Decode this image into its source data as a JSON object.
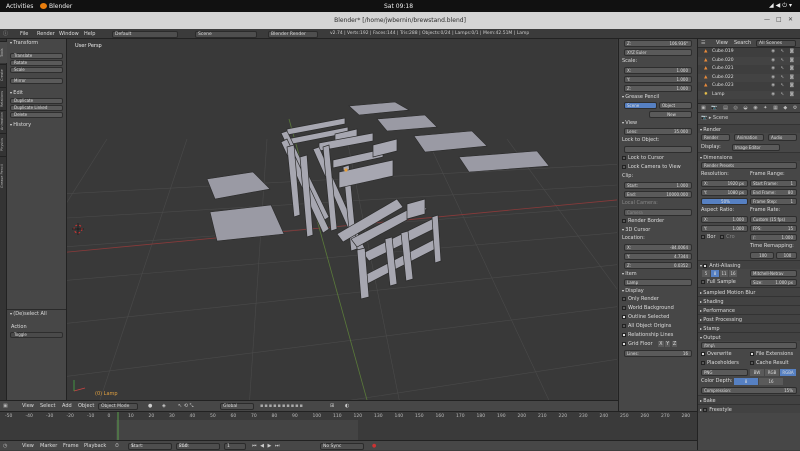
{
  "gnome": {
    "activities": "Activities",
    "app": "Blender",
    "clock": "Sat 09:18"
  },
  "window": {
    "title": "Blender* [/home/jwbernin/brewstand.blend]"
  },
  "infobar": {
    "menus": [
      "File",
      "Render",
      "Window",
      "Help"
    ],
    "layout": "Default",
    "scene": "Scene",
    "engine": "Blender Render",
    "stats": "v2.74 | Verts:192 | Faces:144 | Tris:288 | Objects:0/24 | Lamps:0/1 | Mem:42.51M | Lamp"
  },
  "left_tabs": [
    "Tools",
    "Create",
    "Relations",
    "Animation",
    "Physics",
    "Grease Pencil"
  ],
  "tool_shelf": {
    "transform_header": "Transform",
    "transform_buttons": [
      "Translate",
      "Rotate",
      "Scale"
    ],
    "mirror": "Mirror",
    "edit_header": "Edit",
    "edit_buttons": [
      "Duplicate",
      "Duplicate Linked",
      "Delete"
    ],
    "history_header": "History",
    "operator_header": "(De)select All",
    "action_label": "Action",
    "action_value": "Toggle"
  },
  "viewport": {
    "label": "User Persp",
    "object_label": "(0) Lamp"
  },
  "viewport_header": {
    "menus": [
      "View",
      "Select",
      "Add",
      "Object"
    ],
    "mode": "Object Mode",
    "orientation": "Global"
  },
  "timeline": {
    "ticks": [
      "-50",
      "-40",
      "-30",
      "-20",
      "-10",
      "0",
      "10",
      "20",
      "30",
      "40",
      "50",
      "60",
      "70",
      "80",
      "90",
      "100",
      "110",
      "120",
      "130",
      "140",
      "150",
      "160",
      "170",
      "180",
      "190",
      "200",
      "210",
      "220",
      "230",
      "240",
      "250",
      "260",
      "270",
      "280"
    ],
    "menus": [
      "View",
      "Marker",
      "Frame",
      "Playback"
    ],
    "start": "Start:",
    "start_val": "1",
    "end": "End:",
    "end_val": "250",
    "current": "1",
    "sync": "No Sync"
  },
  "n_panel": {
    "rot_z": "106.936°",
    "rot_mode": "XYZ Euler",
    "scale_label": "Scale:",
    "scale": [
      {
        "axis": "X:",
        "value": "1.000"
      },
      {
        "axis": "Y:",
        "value": "1.000"
      },
      {
        "axis": "Z:",
        "value": "1.000"
      }
    ],
    "grease_header": "Grease Pencil",
    "gp_tabs": [
      "Scene",
      "Object"
    ],
    "gp_new": "New",
    "view_header": "View",
    "lens": "Lens:",
    "lens_val": "35.000",
    "lock_obj": "Lock to Object:",
    "lock_cursor": "Lock to Cursor",
    "lock_camera": "Lock Camera to View",
    "clip": "Clip:",
    "clip_start": "Start:",
    "clip_start_val": "1.000",
    "clip_end": "End:",
    "clip_end_val": "10000.000",
    "local_camera": "Local Camera:",
    "camera": "Camera",
    "render_border": "Render Border",
    "cursor_header": "3D Cursor",
    "location": "Location:",
    "cursor": [
      {
        "axis": "X:",
        "value": "-84.0064"
      },
      {
        "axis": "Y:",
        "value": "4.7344"
      },
      {
        "axis": "Z:",
        "value": "0.0352"
      }
    ],
    "item_header": "Item",
    "item_name": "Lamp",
    "display_header": "Display",
    "display_opts": [
      "Only Render",
      "World Background",
      "Outline Selected",
      "All Object Origins",
      "Relationship Lines"
    ],
    "grid_floor": "Grid Floor",
    "axes": [
      "X",
      "Y",
      "Z"
    ],
    "lines": "Lines:",
    "lines_val": "16"
  },
  "outliner": {
    "menus": [
      "View",
      "Search"
    ],
    "filter": "All Scenes",
    "items": [
      "Cube.019",
      "Cube.020",
      "Cube.021",
      "Cube.022",
      "Cube.023",
      "Lamp"
    ]
  },
  "properties": {
    "render_header": "Render",
    "render_btns": [
      "Render",
      "Animation",
      "Audio"
    ],
    "display": "Display:",
    "display_val": "Image Editor",
    "dimensions_header": "Dimensions",
    "presets": "Render Presets",
    "resolution": "Resolution:",
    "res_x": "X:",
    "res_x_val": "1920 px",
    "res_y": "Y:",
    "res_y_val": "1080 px",
    "res_pct": "50%",
    "frame_range": "Frame Range:",
    "start_frame": "Start Frame:",
    "start_frame_val": "1",
    "end_frame": "End Frame:",
    "end_frame_val": "80",
    "frame_step": "Frame Step:",
    "frame_step_val": "1",
    "aspect": "Aspect Ratio:",
    "asp_x": "X:",
    "asp_x_val": "1.000",
    "asp_y": "Y:",
    "asp_y_val": "1.000",
    "frame_rate": "Frame Rate:",
    "fps_preset": "Custom (15 fps)",
    "fps": "FPS:",
    "fps_val": "15",
    "base": "/:",
    "base_val": "1.000",
    "border": "Bor",
    "crop": "Cro",
    "time_remap": "Time Remapping:",
    "remap_old": "100",
    "remap_new": "100",
    "aa_header": "Anti-Aliasing",
    "aa_samples": [
      "5",
      "8",
      "11",
      "16"
    ],
    "aa_filter": "Mitchell-Netrav",
    "full_sample": "Full Sample",
    "size": "Size:",
    "size_val": "1.000 px",
    "sections": [
      "Sampled Motion Blur",
      "Shading",
      "Performance",
      "Post Processing",
      "Stamp"
    ],
    "output_header": "Output",
    "output_path": "/tmp\\",
    "overwrite": "Overwrite",
    "file_ext": "File Extensions",
    "placeholders": "Placeholders",
    "cache": "Cache Result",
    "format": "PNG",
    "bw": "BW",
    "rgb": "RGB",
    "rgba": "RGBA",
    "color_depth": "Color Depth:",
    "depth8": "8",
    "depth16": "16",
    "compression": "Compression:",
    "compression_val": "15%",
    "bake": "Bake",
    "freestyle": "Freestyle"
  }
}
